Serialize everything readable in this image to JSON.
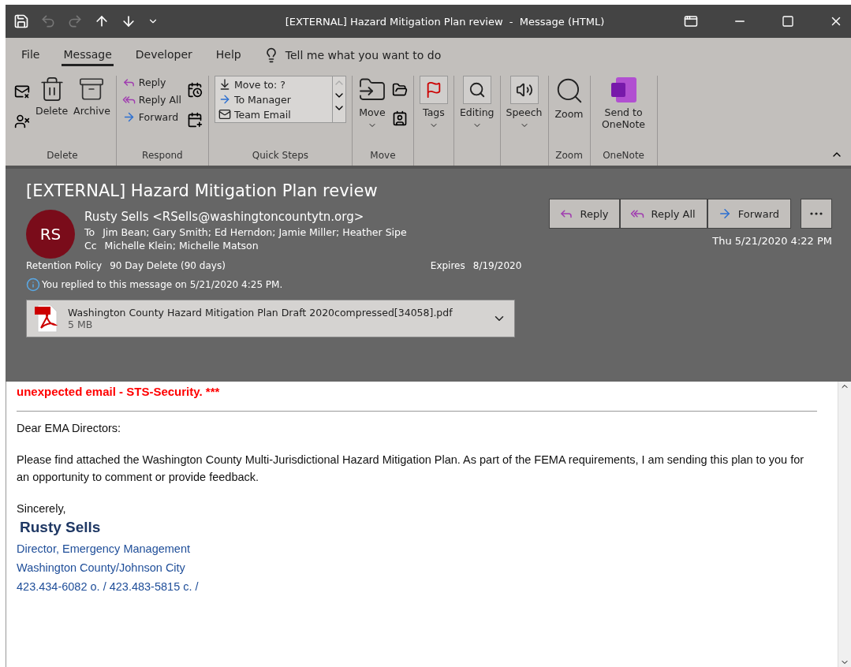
{
  "title_bar": {
    "title": "[EXTERNAL] Hazard Mitigation Plan review  -  Message (HTML)"
  },
  "menu_tabs": [
    {
      "label": "File",
      "selected": false
    },
    {
      "label": "Message",
      "selected": true
    },
    {
      "label": "Developer",
      "selected": false
    },
    {
      "label": "Help",
      "selected": false
    }
  ],
  "tell_me": "Tell me what you want to do",
  "ribbon_groups": [
    {
      "kind": "delete",
      "label": "Delete",
      "items": [
        "Delete",
        "Archive"
      ]
    },
    {
      "kind": "respond",
      "label": "Respond",
      "items": [
        "Reply",
        "Reply All",
        "Forward"
      ]
    },
    {
      "kind": "quick_steps",
      "label": "Quick Steps",
      "items": [
        "Move to: ?",
        "To Manager",
        "Team Email"
      ]
    },
    {
      "kind": "move",
      "label": "Move",
      "items": [
        "Move"
      ]
    },
    {
      "kind": "tags",
      "items": [
        "Tags"
      ]
    },
    {
      "kind": "editing",
      "items": [
        "Editing"
      ]
    },
    {
      "kind": "speech",
      "items": [
        "Speech"
      ]
    },
    {
      "kind": "zoom",
      "label": "Zoom",
      "items": [
        "Zoom"
      ]
    },
    {
      "kind": "onenote",
      "label": "OneNote",
      "items": [
        "Send to OneNote"
      ]
    }
  ],
  "message": {
    "subject": "[EXTERNAL] Hazard Mitigation Plan review",
    "avatar": "RS",
    "sender": "Rusty Sells <RSells@washingtoncountytn.org>",
    "to_label": "To",
    "to": "Jim Bean; Gary Smith; Ed Herndon; Jamie Miller; Heather Sipe",
    "cc_label": "Cc",
    "cc": "Michelle Klein; Michelle Matson",
    "retention_label": "Retention Policy",
    "retention": "90 Day Delete (90 days)",
    "expires_label": "Expires",
    "expires": "8/19/2020",
    "info": "You replied to this message on 5/21/2020 4:25 PM.",
    "date": "Thu 5/21/2020 4:22 PM",
    "actions": [
      {
        "kind": "reply",
        "label": "Reply"
      },
      {
        "kind": "reply_all",
        "label": "Reply All"
      },
      {
        "kind": "forward",
        "label": "Forward"
      }
    ],
    "attachment": {
      "name": "Washington County Hazard Mitigation Plan Draft 2020compressed[34058].pdf",
      "size": "5 MB"
    }
  },
  "body": {
    "warning": "unexpected email - STS-Security. ***",
    "greeting": "Dear EMA Directors:",
    "paragraph": "Please find attached the Washington County Multi-Jurisdictional Hazard Mitigation Plan. As part of the FEMA requirements, I am sending this plan to you for an opportunity to comment or provide feedback.",
    "closing": "Sincerely,",
    "signature_name": "Rusty Sells",
    "signature_lines": [
      "Director, Emergency Management",
      "Washington County/Johnson City",
      "423.434-6082 o. / 423.483-5815 c. /"
    ]
  }
}
